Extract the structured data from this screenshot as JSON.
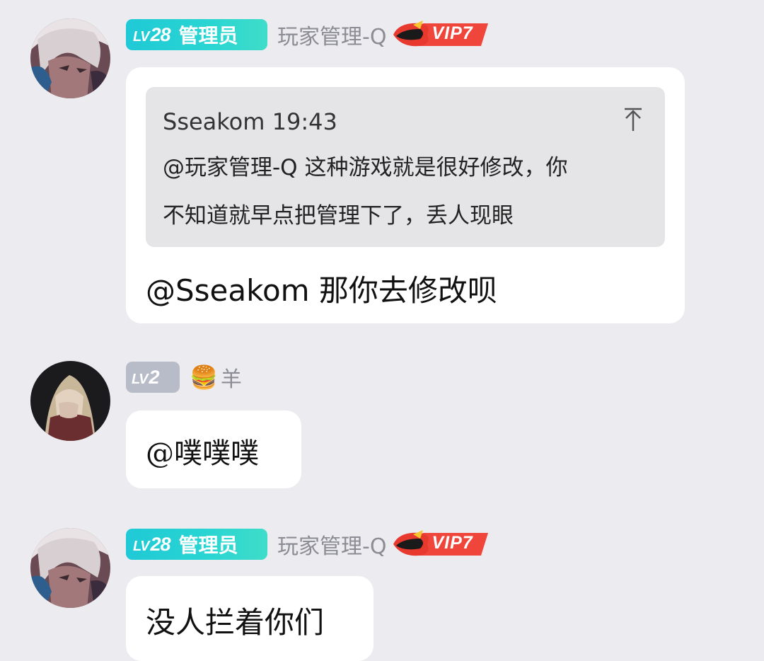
{
  "messages": [
    {
      "level": "28",
      "level_prefix": "LV",
      "role": "管理员",
      "username": "玩家管理-Q",
      "vip": "VIP7",
      "quote": {
        "author_time": "Sseakom 19:43",
        "line1": "@玩家管理-Q 这种游戏就是很好修改，你",
        "line2": "不知道就早点把管理下了，丢人现眼"
      },
      "text": "@Sseakom 那你去修改呗"
    },
    {
      "level": "2",
      "level_prefix": "LV",
      "username": "羊",
      "name_emoji": "🍔",
      "text": "@噗噗噗"
    },
    {
      "level": "28",
      "level_prefix": "LV",
      "role": "管理员",
      "username": "玩家管理-Q",
      "vip": "VIP7",
      "text": "没人拦着你们"
    }
  ],
  "icons": {
    "pin": "pin-to-top-icon",
    "vip_flame": "vip-flame-icon"
  },
  "colors": {
    "background": "#ecebf0",
    "admin_badge": "#25cfd4",
    "member_badge": "#b7bcc8",
    "vip_red": "#f0453a"
  }
}
